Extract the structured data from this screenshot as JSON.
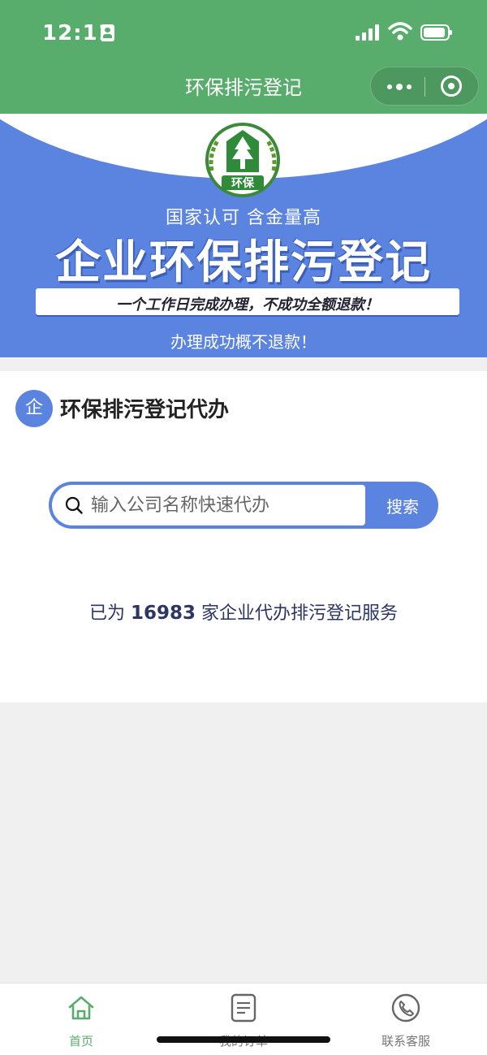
{
  "status_bar": {
    "time": "12:11"
  },
  "nav": {
    "title": "环保排污登记"
  },
  "banner": {
    "logo_text": "环保",
    "subtitle": "国家认可 含金量高",
    "title": "企业环保排污登记",
    "promise": "一个工作日完成办理，不成功全额退款！",
    "note": "办理成功概不退款！"
  },
  "section": {
    "badge": "企",
    "title": "环保排污登记代办"
  },
  "search": {
    "placeholder": "输入公司名称快速代办",
    "value": "",
    "button_label": "搜索"
  },
  "stats": {
    "prefix": "已为",
    "count": "16983",
    "suffix": "家企业代办排污登记服务"
  },
  "tabbar": {
    "items": [
      {
        "label": "首页",
        "icon": "home-icon",
        "active": true
      },
      {
        "label": "我的订单",
        "icon": "document-icon",
        "active": false
      },
      {
        "label": "联系客服",
        "icon": "phone-icon",
        "active": false
      }
    ]
  },
  "colors": {
    "nav_green": "#58ad6c",
    "brand_blue": "#5b83e0",
    "stats_text": "#2c3564",
    "background": "#f0f0f0"
  }
}
